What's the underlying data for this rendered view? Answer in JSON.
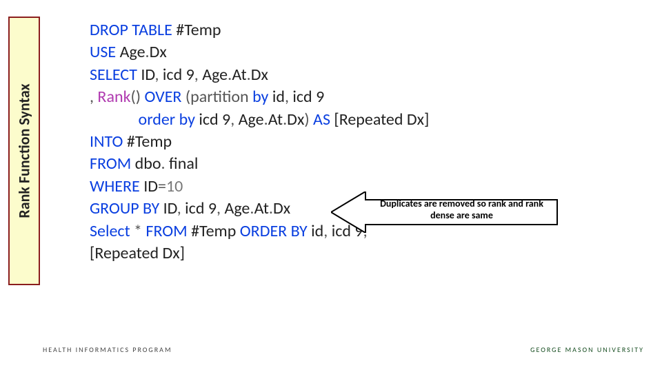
{
  "sidebar": {
    "label": "Rank Function Syntax"
  },
  "code": {
    "l1_a": "DROP",
    "l1_b": " TABLE",
    "l1_c": " #Temp",
    "l2_a": "USE",
    "l2_b": " Age",
    "l2_c": ".",
    "l2_d": "Dx",
    "l3_a": "SELECT",
    "l3_b": " ID",
    "l3_c": ",",
    "l3_d": " icd 9",
    "l3_e": ",",
    "l3_f": " Age",
    "l3_g": ".",
    "l3_h": "At",
    "l3_i": ".",
    "l3_j": "Dx",
    "l4_a": ",",
    "l4_b": " Rank",
    "l4_c": "()",
    "l4_d": " OVER ",
    "l4_e": "(partition",
    "l4_f": " by",
    "l4_g": " id",
    "l4_h": ",",
    "l4_i": " icd 9",
    "l5_a": "             order",
    "l5_b": " by",
    "l5_c": " icd 9",
    "l5_d": ",",
    "l5_e": " Age",
    "l5_f": ".",
    "l5_g": "At",
    "l5_h": ".",
    "l5_i": "Dx",
    "l5_j": ")",
    "l5_k": " AS",
    "l5_l": " [Repeated Dx]",
    "l6_a": "INTO",
    "l6_b": " #Temp",
    "l7_a": "FROM",
    "l7_b": " dbo",
    "l7_c": ".",
    "l7_d": " final",
    "l8_a": "WHERE",
    "l8_b": " ID",
    "l8_c": "=",
    "l8_d": "10",
    "l9_a": "GROUP",
    "l9_b": " BY",
    "l9_c": " ID",
    "l9_d": ",",
    "l9_e": " icd 9",
    "l9_f": ",",
    "l9_g": " Age",
    "l9_h": ".",
    "l9_i": "At",
    "l9_j": ".",
    "l9_k": "Dx",
    "l10_a": "Select",
    "l10_b": " *",
    "l10_c": " FROM",
    "l10_d": " #Temp",
    "l10_e": " ORDER",
    "l10_f": " BY",
    "l10_g": " id",
    "l10_h": ",",
    "l10_i": " icd 9",
    "l10_j": ",",
    "l11_a": "[Repeated Dx]"
  },
  "callout": {
    "text": "Duplicates are removed so rank and rank dense are same"
  },
  "footer": {
    "left": "HEALTH INFORMATICS PROGRAM",
    "right": "GEORGE MASON UNIVERSITY"
  }
}
